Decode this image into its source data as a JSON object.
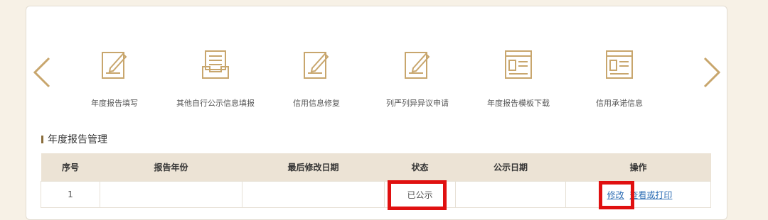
{
  "nav": {
    "prev_icon": "chevron-left-icon",
    "next_icon": "chevron-right-icon",
    "accent_color": "#c8a66d",
    "items": [
      {
        "label": "年度报告填写",
        "icon": "edit-document-icon"
      },
      {
        "label": "其他自行公示信息填报",
        "icon": "inbox-document-icon"
      },
      {
        "label": "信用信息修复",
        "icon": "edit-document-icon"
      },
      {
        "label": "列严列异异议申请",
        "icon": "edit-document-icon"
      },
      {
        "label": "年度报告模板下载",
        "icon": "template-window-icon"
      },
      {
        "label": "信用承诺信息",
        "icon": "template-window-icon"
      }
    ]
  },
  "section": {
    "title": "年度报告管理"
  },
  "table": {
    "headers": [
      "序号",
      "报告年份",
      "最后修改日期",
      "状态",
      "公示日期",
      "操作"
    ],
    "rows": [
      {
        "index": "1",
        "year": "",
        "modified": "",
        "status": "已公示",
        "publish_date": "",
        "edit": "修改",
        "view": "查看或打印"
      }
    ]
  },
  "colors": {
    "highlight": "#e01010",
    "header_bg": "#ece3d5",
    "link": "#2f6fb5",
    "page_bg": "#f7f1e6"
  }
}
